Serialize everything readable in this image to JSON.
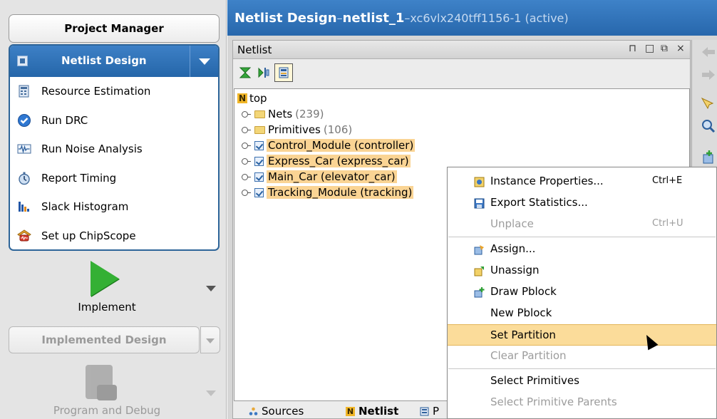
{
  "left_panel": {
    "project_manager": "Project Manager",
    "netlist_design": {
      "title": "Netlist Design",
      "items": [
        {
          "label": "Resource Estimation",
          "icon": "resource-estimation-icon"
        },
        {
          "label": "Run DRC",
          "icon": "run-drc-icon"
        },
        {
          "label": "Run Noise Analysis",
          "icon": "noise-analysis-icon"
        },
        {
          "label": "Report Timing",
          "icon": "stopwatch-icon"
        },
        {
          "label": "Slack Histogram",
          "icon": "histogram-icon"
        },
        {
          "label": "Set up ChipScope",
          "icon": "chipscope-icon"
        }
      ]
    },
    "implement": "Implement",
    "implemented_design": "Implemented Design",
    "program_and_debug": "Program and Debug"
  },
  "title_bar": {
    "prefix": "Netlist Design",
    "separator1": " – ",
    "netlist_name": "netlist_1",
    "separator2": " – ",
    "part": "xc6vlx240tff1156-1 (active)"
  },
  "netlist_view": {
    "title": "Netlist",
    "window_controls": [
      "⊓",
      "□",
      "⧉",
      "×"
    ],
    "tree": {
      "root": "top",
      "folders": [
        {
          "name": "Nets",
          "count": "(239)"
        },
        {
          "name": "Primitives",
          "count": "(106)"
        }
      ],
      "cells": [
        "Control_Module (controller)",
        "Express_Car (express_car)",
        "Main_Car (elevator_car)",
        "Tracking_Module (tracking)"
      ]
    },
    "tabs": [
      "Sources",
      "Netlist",
      "P"
    ]
  },
  "context_menu": {
    "items": [
      {
        "label": "Instance Properties...",
        "shortcut": "Ctrl+E",
        "enabled": true
      },
      {
        "label": "Export Statistics...",
        "shortcut": "",
        "enabled": true
      },
      {
        "label": "Unplace",
        "shortcut": "Ctrl+U",
        "enabled": false
      },
      {
        "label": "Assign...",
        "shortcut": "",
        "enabled": true
      },
      {
        "label": "Unassign",
        "shortcut": "",
        "enabled": true
      },
      {
        "label": "Draw Pblock",
        "shortcut": "",
        "enabled": true
      },
      {
        "label": "New Pblock",
        "shortcut": "",
        "enabled": true
      },
      {
        "label": "Set Partition",
        "shortcut": "",
        "enabled": true,
        "highlighted": true
      },
      {
        "label": "Clear Partition",
        "shortcut": "",
        "enabled": false
      },
      {
        "label": "Select Primitives",
        "shortcut": "",
        "enabled": true
      },
      {
        "label": "Select Primitive Parents",
        "shortcut": "",
        "enabled": false
      }
    ]
  },
  "colors": {
    "title_blue": "#2767ac",
    "highlight": "#fbdc9a",
    "selection": "#fad494",
    "run_green": "#34b034"
  }
}
